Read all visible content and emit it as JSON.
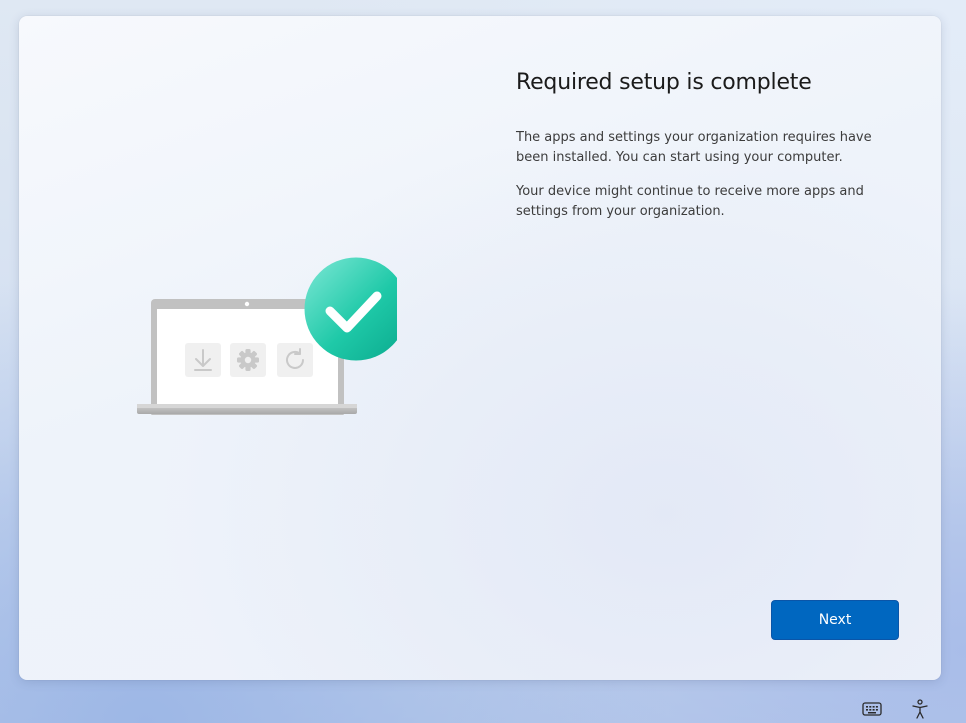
{
  "window": {
    "title": "Required setup is complete",
    "paragraphs": [
      "The apps and settings your organization requires have been installed. You can start using your computer.",
      "Your device might continue to receive more apps and settings from your organization."
    ],
    "next_label": "Next"
  },
  "illustration": {
    "tiles": [
      "download-icon",
      "gear-icon",
      "refresh-icon"
    ],
    "badge": "checkmark-icon",
    "badge_color": "#1fc9a8"
  },
  "taskbar": {
    "icons": [
      "keyboard-icon",
      "accessibility-icon"
    ]
  },
  "colors": {
    "accent": "#0067c0",
    "text": "#1b1b1b"
  }
}
